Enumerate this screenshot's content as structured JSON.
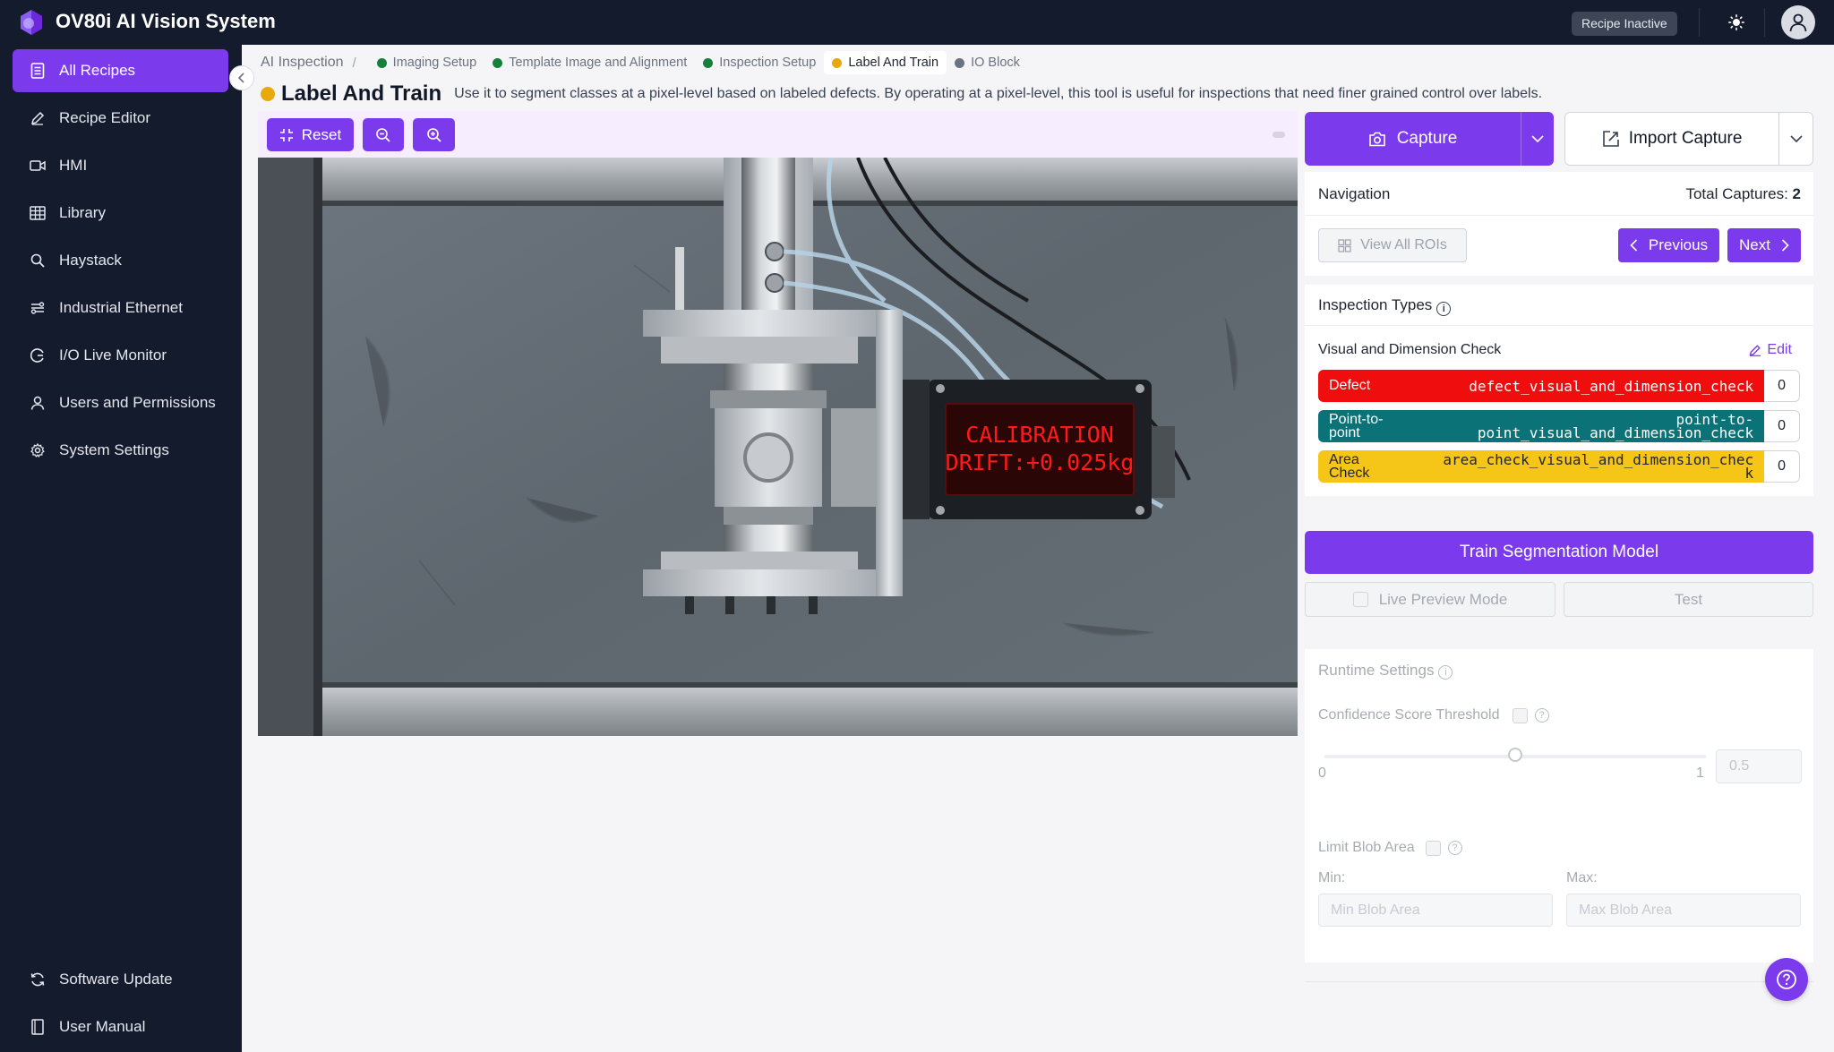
{
  "app": {
    "title": "OV80i AI Vision System",
    "recipe_status": "Recipe Inactive"
  },
  "sidebar": {
    "items": [
      {
        "label": "All Recipes",
        "icon": "document-list-icon",
        "active": true
      },
      {
        "label": "Recipe Editor",
        "icon": "pencil-icon"
      },
      {
        "label": "HMI",
        "icon": "video-camera-icon"
      },
      {
        "label": "Library",
        "icon": "grid-table-icon"
      },
      {
        "label": "Haystack",
        "icon": "search-icon"
      },
      {
        "label": "Industrial Ethernet",
        "icon": "network-icon"
      },
      {
        "label": "I/O Live Monitor",
        "icon": "gauge-icon"
      },
      {
        "label": "Users and Permissions",
        "icon": "user-icon"
      },
      {
        "label": "System Settings",
        "icon": "gear-icon"
      }
    ],
    "bottom_items": [
      {
        "label": "Software Update",
        "icon": "refresh-icon"
      },
      {
        "label": "User Manual",
        "icon": "book-icon"
      }
    ]
  },
  "breadcrumb": {
    "root": "AI Inspection",
    "separator": "/",
    "steps": [
      {
        "label": "Imaging Setup",
        "status_color": "#15803d"
      },
      {
        "label": "Template Image and Alignment",
        "status_color": "#15803d"
      },
      {
        "label": "Inspection Setup",
        "status_color": "#15803d"
      },
      {
        "label": "Label And Train",
        "status_color": "#e8a90c",
        "current": true
      },
      {
        "label": "IO Block",
        "status_color": "#6b7280"
      }
    ]
  },
  "page": {
    "title": "Label And Train",
    "description": "Use it to segment classes at a pixel-level based on labeled defects. By operating at a pixel-level, this tool is useful for inspections that need finer grained control over labels."
  },
  "image_toolbar": {
    "reset_label": "Reset"
  },
  "image": {
    "display_line1": "CALIBRATION",
    "display_line2": "DRIFT:+0.025kg"
  },
  "capture": {
    "capture_label": "Capture",
    "import_label": "Import Capture"
  },
  "navigation": {
    "title": "Navigation",
    "total_label": "Total Captures:",
    "total_value": "2",
    "view_all_label": "View All ROIs",
    "previous_label": "Previous",
    "next_label": "Next"
  },
  "inspection_types": {
    "title": "Inspection Types",
    "check_name": "Visual and Dimension Check",
    "edit_label": "Edit",
    "classes": [
      {
        "label": "Defect",
        "id": "defect_visual_and_dimension_check",
        "count": "0",
        "color": "#ef0d0d",
        "text_color": "#ffffff"
      },
      {
        "label": "Point-to-\npoint",
        "id": "point-to-\npoint_visual_and_dimension_check",
        "count": "0",
        "color": "#0b7278",
        "text_color": "#ffffff"
      },
      {
        "label": "Area\nCheck",
        "id": "area_check_visual_and_dimension_chec\nk",
        "count": "0",
        "color": "#f5c518",
        "text_color": "#1f2430"
      }
    ]
  },
  "training": {
    "train_label": "Train Segmentation Model",
    "live_preview_label": "Live Preview Mode",
    "test_label": "Test"
  },
  "runtime": {
    "title": "Runtime Settings",
    "confidence_label": "Confidence Score Threshold",
    "slider_min": "0",
    "slider_max": "1",
    "slider_value": 0.5,
    "threshold_value": "0.5",
    "limit_blob_label": "Limit Blob Area",
    "min_label": "Min:",
    "max_label": "Max:",
    "min_placeholder": "Min Blob Area",
    "max_placeholder": "Max Blob Area"
  },
  "colors": {
    "accent": "#7c3aed",
    "topbar": "#141b2d"
  }
}
